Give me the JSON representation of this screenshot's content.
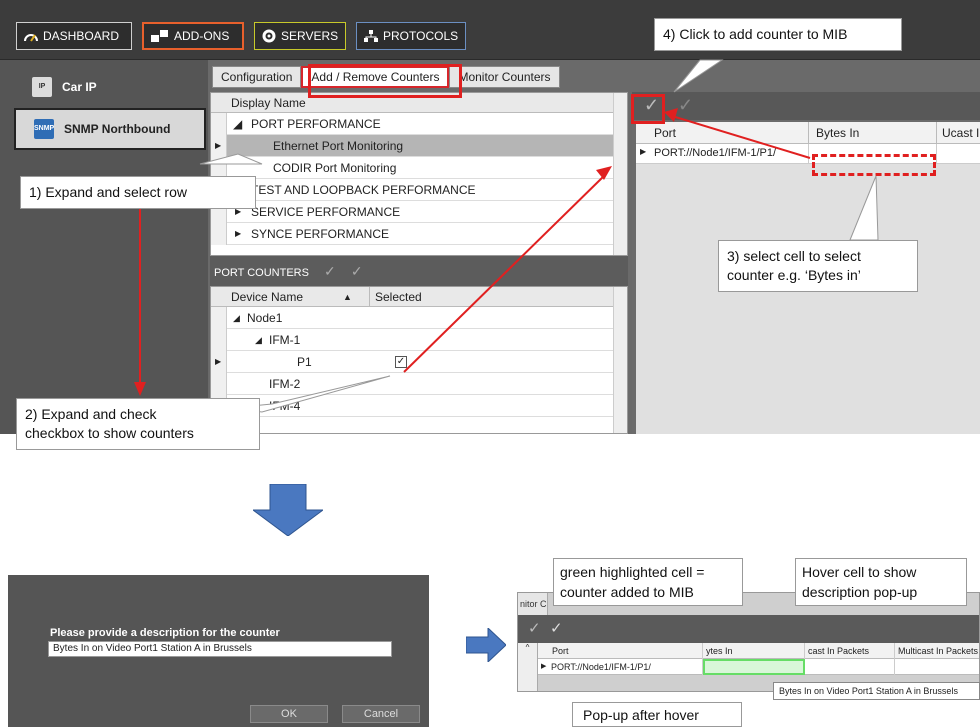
{
  "nav": {
    "dashboard": "DASHBOARD",
    "addons": "ADD-ONS",
    "servers": "SERVERS",
    "protocols": "PROTOCOLS"
  },
  "sidebar": {
    "items": [
      {
        "label": "Car IP",
        "icon": "car-ip-icon"
      },
      {
        "label": "SNMP Northbound",
        "icon": "snmp-icon",
        "icon_text": "SNMP"
      }
    ]
  },
  "tabs": [
    "Configuration",
    "Add / Remove Counters",
    "Monitor Counters"
  ],
  "display_grid": {
    "header": "Display Name",
    "rows": [
      "PORT PERFORMANCE",
      "Ethernet Port Monitoring",
      "CODIR Port Monitoring",
      "TEST AND LOOPBACK PERFORMANCE",
      "SERVICE PERFORMANCE",
      "SYNCE PERFORMANCE"
    ]
  },
  "port_counters": {
    "title": "PORT COUNTERS",
    "headers": [
      "Device Name",
      "Selected"
    ],
    "rows": [
      "Node1",
      "IFM-1",
      "P1",
      "IFM-2",
      "IFM-4"
    ]
  },
  "right_grid": {
    "headers": [
      "Port",
      "Bytes In",
      "Ucast I"
    ],
    "row_port": "PORT://Node1/IFM-1/P1/"
  },
  "callouts": {
    "c1": "1) Expand and select row",
    "c2_line1": "2) Expand and check",
    "c2_line2": "checkbox to show counters",
    "c3_line1": "3) select cell to select",
    "c3_line2": "counter e.g. ‘Bytes in’",
    "c4": "4) Click to add counter to MIB",
    "green_line1": "green highlighted cell =",
    "green_line2": "counter added to MIB",
    "hover_line1": "Hover cell to show",
    "hover_line2": "description pop-up",
    "popup": "Pop-up after hover"
  },
  "dialog": {
    "title": "Please provide a description for the counter",
    "value": "Bytes In on Video Port1 Station A in Brussels",
    "ok": "OK",
    "cancel": "Cancel"
  },
  "result": {
    "tab_label": "nitor C",
    "headers": [
      "Port",
      "ytes In",
      "cast In Packets",
      "Multicast In Packets"
    ],
    "row_port": "PORT://Node1/IFM-1/P1/",
    "tooltip": "Bytes In on Video Port1 Station A in Brussels"
  },
  "colors": {
    "accent_red": "#e02020",
    "addons_border": "#e8602c",
    "servers_border": "#c7c92a",
    "protocols_border": "#6b8fc2",
    "arrow_blue": "#4a78c0",
    "green_highlight": "#66dd66"
  }
}
